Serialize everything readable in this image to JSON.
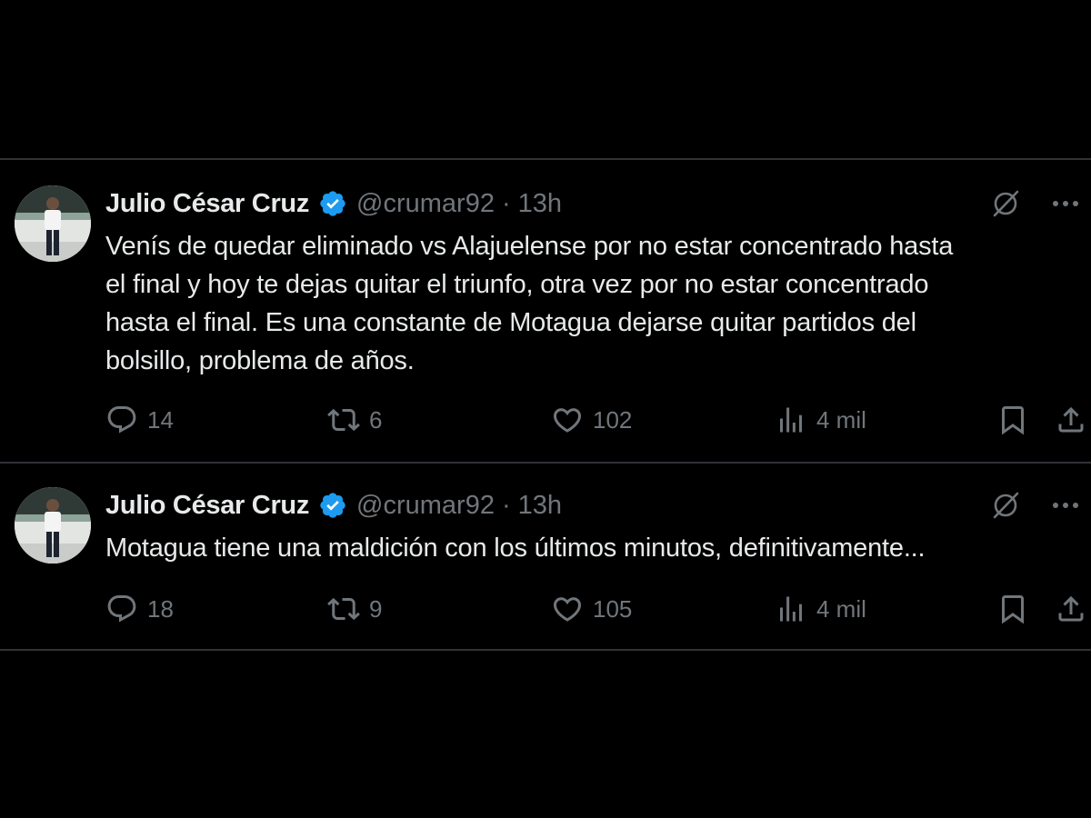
{
  "tweets": [
    {
      "author": "Julio César Cruz",
      "handle": "@crumar92",
      "separator": "·",
      "time": "13h",
      "text_lines": [
        "Venís de quedar eliminado vs Alajuelense por no estar concentrado hasta",
        "el final y hoy te dejas quitar el triunfo, otra vez por no estar concentrado",
        "hasta el final. Es una constante de Motagua dejarse quitar partidos del",
        "bolsillo, problema de años."
      ],
      "replies": "14",
      "reposts": "6",
      "likes": "102",
      "views": "4 mil"
    },
    {
      "author": "Julio César Cruz",
      "handle": "@crumar92",
      "separator": "·",
      "time": "13h",
      "text_lines": [
        "Motagua tiene una maldición con los últimos minutos, definitivamente..."
      ],
      "replies": "18",
      "reposts": "9",
      "likes": "105",
      "views": "4 mil"
    }
  ],
  "icons": {
    "verified": "verified-badge-icon",
    "grok": "grok-icon",
    "more": "more-icon",
    "reply": "reply-icon",
    "repost": "repost-icon",
    "like": "heart-icon",
    "views": "views-icon",
    "bookmark": "bookmark-icon",
    "share": "share-icon"
  },
  "colors": {
    "background": "#000000",
    "text": "#e7e9ea",
    "muted": "#71767b",
    "divider": "#2f3336",
    "verified": "#1d9bf0"
  }
}
